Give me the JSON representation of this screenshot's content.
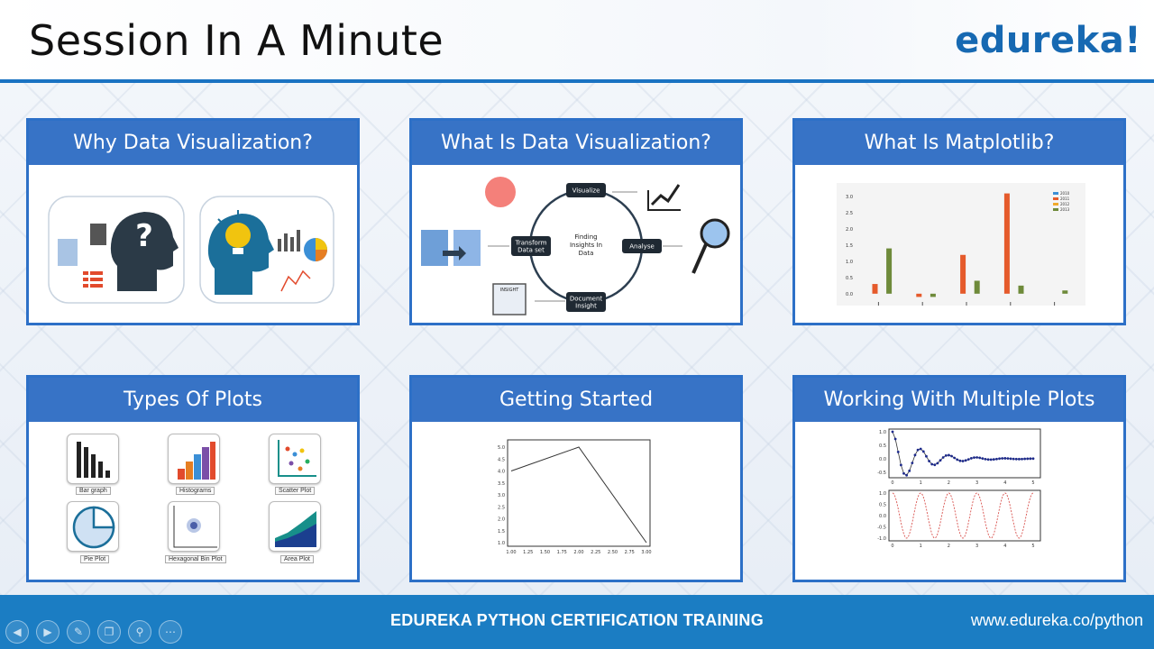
{
  "slide": {
    "title": "Session In A Minute",
    "logo": "edureka!"
  },
  "cards": [
    {
      "title": "Why Data Visualization?"
    },
    {
      "title": "What Is Data Visualization?",
      "cycle": {
        "center": "Finding\nInsights In\nData",
        "nodes": [
          "Visualize",
          "Analyse",
          "Document\nInsight",
          "Transform\nData set"
        ],
        "insight_tag": "INSIGHT"
      }
    },
    {
      "title": "What Is Matplotlib?"
    },
    {
      "title": "Types Of Plots",
      "plot_types": [
        "Bar graph",
        "Histograms",
        "Scatter Plot",
        "Pie Plot",
        "Hexagonal Bin Plot",
        "Area Plot"
      ]
    },
    {
      "title": "Getting Started"
    },
    {
      "title": "Working With Multiple Plots"
    }
  ],
  "footer": {
    "center_text": "EDUREKA PYTHON CERTIFICATION TRAINING",
    "url": "www.edureka.co/python"
  },
  "player_controls": [
    "prev-icon",
    "next-icon",
    "pen-icon",
    "copy-icon",
    "zoom-icon",
    "more-icon"
  ],
  "colors": {
    "accent": "#3773c6",
    "footer": "#1b7dc3",
    "logo": "#1769b2"
  },
  "chart_data": [
    {
      "type": "bar",
      "categories": [
        "",
        "",
        "",
        "",
        ""
      ],
      "series": [
        {
          "name": "2010",
          "values": [
            0,
            0,
            0,
            0,
            0
          ]
        },
        {
          "name": "2011",
          "values": [
            0.3,
            -0.1,
            1.2,
            3.1,
            0
          ]
        },
        {
          "name": "2012",
          "values": [
            0,
            0,
            0,
            0,
            0
          ]
        },
        {
          "name": "2013",
          "values": [
            1.4,
            -0.1,
            0.4,
            0.25,
            0.1
          ]
        }
      ],
      "ylim": [
        -0.2,
        3.2
      ],
      "legend": "top-right",
      "y_ticks": [
        "0.0",
        "0.5",
        "1.0",
        "1.5",
        "2.0",
        "2.5",
        "3.0"
      ]
    },
    {
      "type": "line",
      "x": [
        1.0,
        2.0,
        3.0
      ],
      "y": [
        4.0,
        5.0,
        1.0
      ],
      "xlim": [
        1.0,
        3.0
      ],
      "ylim": [
        1.0,
        5.0
      ],
      "x_ticks": [
        "1.00",
        "1.25",
        "1.50",
        "1.75",
        "2.00",
        "2.25",
        "2.50",
        "2.75",
        "3.00"
      ],
      "y_ticks": [
        "1.0",
        "1.5",
        "2.0",
        "2.5",
        "3.0",
        "3.5",
        "4.0",
        "4.5",
        "5.0"
      ]
    },
    {
      "type": "line",
      "subplots": [
        {
          "name": "damped",
          "xlim": [
            0,
            5
          ],
          "ylim": [
            -0.6,
            1.0
          ],
          "y_ticks": [
            "1.0",
            "0.5",
            "0.0",
            "-0.5"
          ],
          "x_ticks": [
            "0",
            "1",
            "2",
            "3",
            "4",
            "5"
          ]
        },
        {
          "name": "cosine",
          "xlim": [
            0,
            5
          ],
          "ylim": [
            -1.0,
            1.0
          ],
          "y_ticks": [
            "1.0",
            "0.5",
            "0.0",
            "-0.5",
            "-1.0"
          ],
          "x_ticks": [
            "0",
            "1",
            "2",
            "3",
            "4",
            "5"
          ]
        }
      ]
    }
  ]
}
